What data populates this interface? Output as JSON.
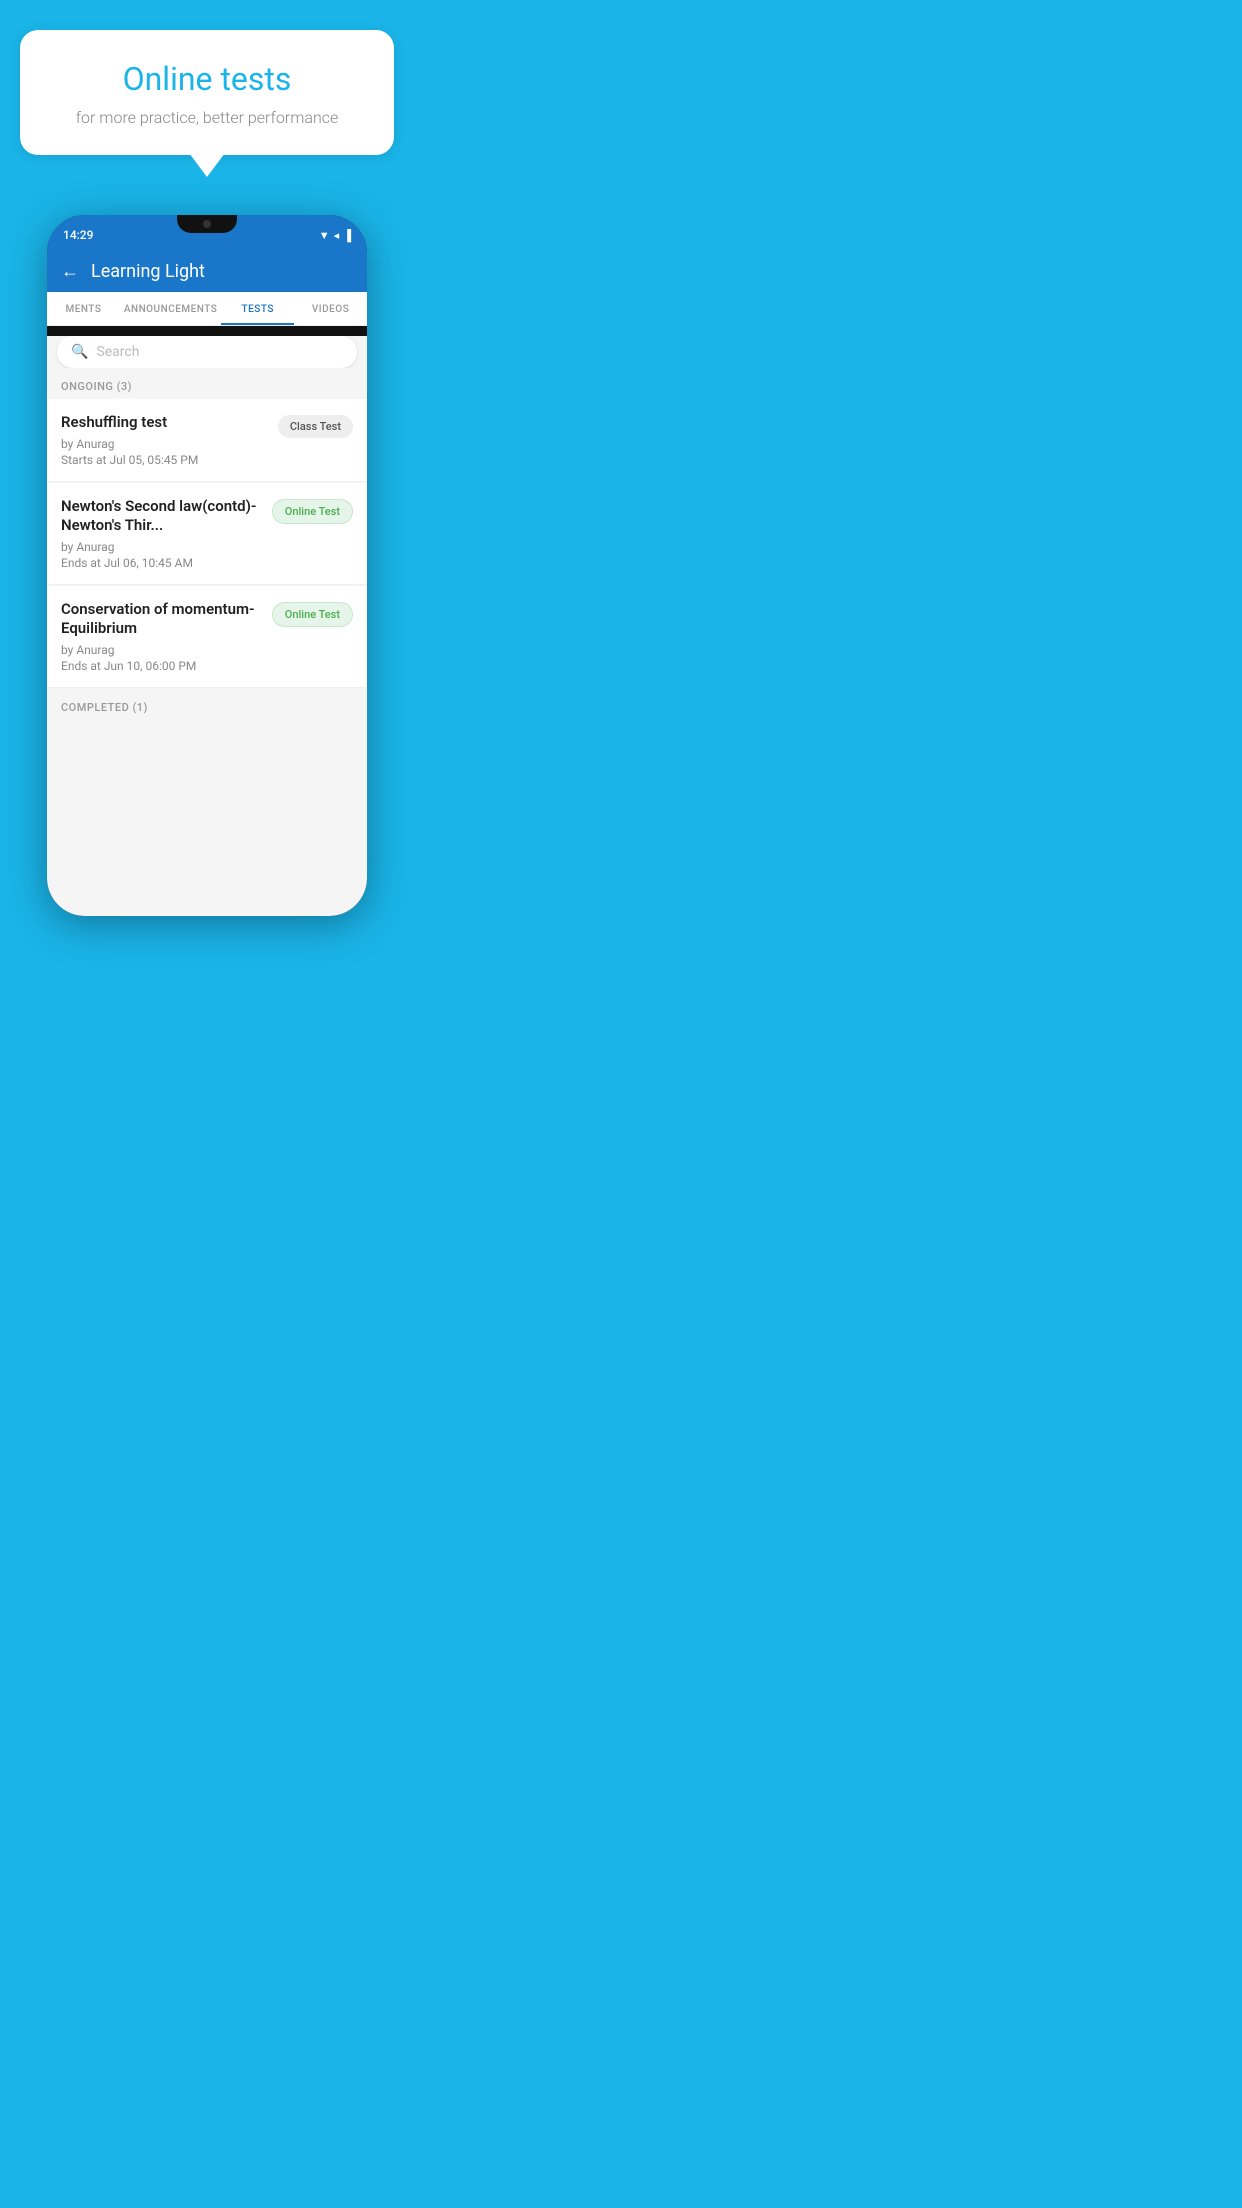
{
  "bubble": {
    "title": "Online tests",
    "subtitle": "for more practice, better performance"
  },
  "phone": {
    "status": {
      "time": "14:29",
      "icons": "▼◀▐"
    },
    "header": {
      "back_label": "←",
      "title": "Learning Light"
    },
    "tabs": [
      {
        "label": "MENTS",
        "active": false
      },
      {
        "label": "ANNOUNCEMENTS",
        "active": false
      },
      {
        "label": "TESTS",
        "active": true
      },
      {
        "label": "VIDEOS",
        "active": false
      }
    ],
    "search": {
      "placeholder": "Search"
    },
    "ongoing_section": {
      "label": "ONGOING (3)"
    },
    "tests": [
      {
        "title": "Reshuffling test",
        "by": "by Anurag",
        "date": "Starts at  Jul 05, 05:45 PM",
        "badge": "Class Test",
        "badge_type": "class"
      },
      {
        "title": "Newton's Second law(contd)-Newton's Thir...",
        "by": "by Anurag",
        "date": "Ends at  Jul 06, 10:45 AM",
        "badge": "Online Test",
        "badge_type": "online"
      },
      {
        "title": "Conservation of momentum-Equilibrium",
        "by": "by Anurag",
        "date": "Ends at  Jun 10, 06:00 PM",
        "badge": "Online Test",
        "badge_type": "online"
      }
    ],
    "completed_section": {
      "label": "COMPLETED (1)"
    }
  }
}
